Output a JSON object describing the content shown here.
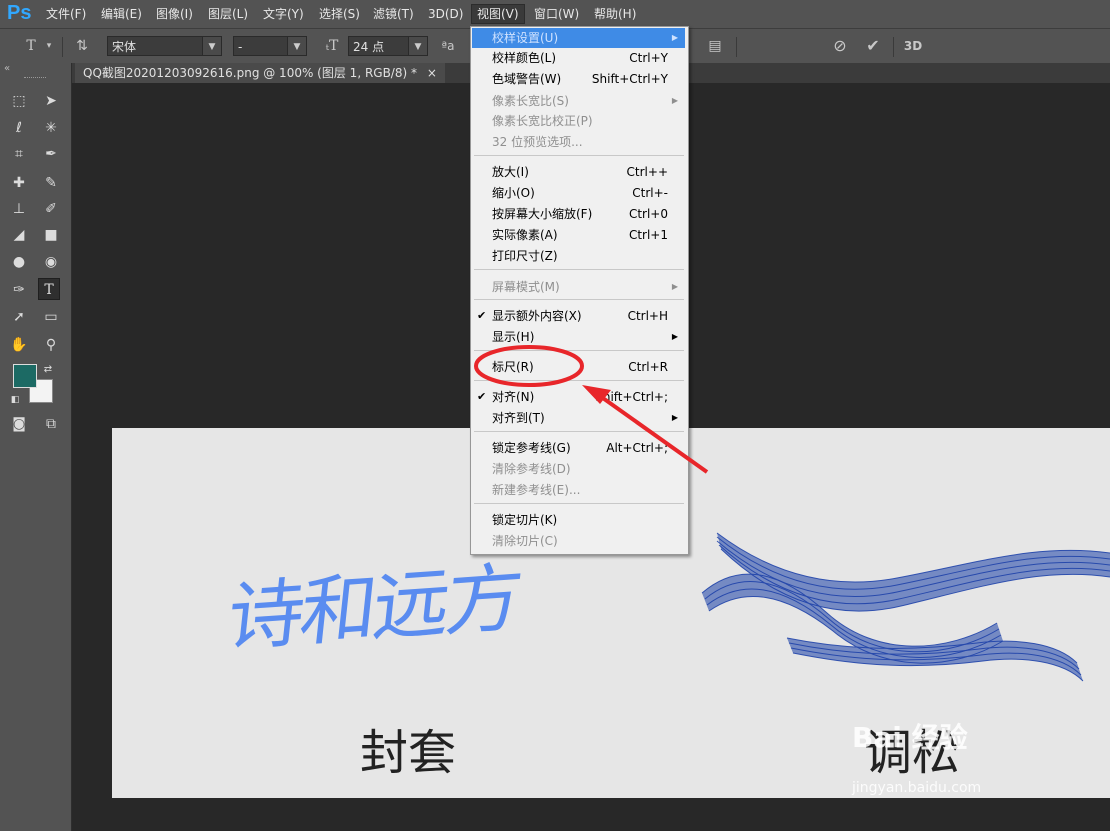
{
  "app": {
    "logo": "Ps"
  },
  "menubar": {
    "items": [
      "文件(F)",
      "编辑(E)",
      "图像(I)",
      "图层(L)",
      "文字(Y)",
      "选择(S)",
      "滤镜(T)",
      "3D(D)",
      "视图(V)",
      "窗口(W)",
      "帮助(H)"
    ],
    "active": "视图(V)"
  },
  "options": {
    "font_family": "宋体",
    "font_style": "-",
    "font_size": "24 点",
    "aa_label": "ªa",
    "three_d_label": "3D"
  },
  "document_tab": {
    "title": "QQ截图20201203092616.png @ 100% (图层 1, RGB/8) *",
    "close": "×"
  },
  "colors": {
    "foreground": "#1c6a64",
    "background": "#f3f3f3",
    "highlight": "#3f8be6",
    "annotation": "#e8262a"
  },
  "view_menu": {
    "items": [
      {
        "label": "校样设置(U)",
        "shortcut": "",
        "submenu": true,
        "disabled": false,
        "checked": false,
        "highlighted": true
      },
      {
        "label": "校样颜色(L)",
        "shortcut": "Ctrl+Y",
        "submenu": false,
        "disabled": false,
        "checked": false
      },
      {
        "label": "色域警告(W)",
        "shortcut": "Shift+Ctrl+Y",
        "submenu": false,
        "disabled": false,
        "checked": false
      },
      {
        "label": "像素长宽比(S)",
        "shortcut": "",
        "submenu": true,
        "disabled": true,
        "checked": false
      },
      {
        "label": "像素长宽比校正(P)",
        "shortcut": "",
        "submenu": false,
        "disabled": true,
        "checked": false
      },
      {
        "label": "32 位预览选项...",
        "shortcut": "",
        "submenu": false,
        "disabled": true,
        "checked": false
      },
      {
        "label": "放大(I)",
        "shortcut": "Ctrl++",
        "submenu": false,
        "disabled": false,
        "checked": false
      },
      {
        "label": "缩小(O)",
        "shortcut": "Ctrl+-",
        "submenu": false,
        "disabled": false,
        "checked": false
      },
      {
        "label": "按屏幕大小缩放(F)",
        "shortcut": "Ctrl+0",
        "submenu": false,
        "disabled": false,
        "checked": false
      },
      {
        "label": "实际像素(A)",
        "shortcut": "Ctrl+1",
        "submenu": false,
        "disabled": false,
        "checked": false
      },
      {
        "label": "打印尺寸(Z)",
        "shortcut": "",
        "submenu": false,
        "disabled": false,
        "checked": false
      },
      {
        "label": "屏幕模式(M)",
        "shortcut": "",
        "submenu": true,
        "disabled": true,
        "checked": false
      },
      {
        "label": "显示额外内容(X)",
        "shortcut": "Ctrl+H",
        "submenu": false,
        "disabled": false,
        "checked": true
      },
      {
        "label": "显示(H)",
        "shortcut": "",
        "submenu": true,
        "disabled": false,
        "checked": false
      },
      {
        "label": "标尺(R)",
        "shortcut": "Ctrl+R",
        "submenu": false,
        "disabled": false,
        "checked": false
      },
      {
        "label": "对齐(N)",
        "shortcut": "Shift+Ctrl+;",
        "submenu": false,
        "disabled": false,
        "checked": true
      },
      {
        "label": "对齐到(T)",
        "shortcut": "",
        "submenu": true,
        "disabled": false,
        "checked": false
      },
      {
        "label": "锁定参考线(G)",
        "shortcut": "Alt+Ctrl+;",
        "submenu": false,
        "disabled": false,
        "checked": false
      },
      {
        "label": "清除参考线(D)",
        "shortcut": "",
        "submenu": false,
        "disabled": true,
        "checked": false
      },
      {
        "label": "新建参考线(E)...",
        "shortcut": "",
        "submenu": false,
        "disabled": true,
        "checked": false
      },
      {
        "label": "锁定切片(K)",
        "shortcut": "",
        "submenu": false,
        "disabled": false,
        "checked": false
      },
      {
        "label": "清除切片(C)",
        "shortcut": "",
        "submenu": false,
        "disabled": true,
        "checked": false
      }
    ]
  },
  "canvas": {
    "title_text": "诗和远方",
    "left_label": "封套",
    "right_label": "调松",
    "watermark": "Bai 经验",
    "watermark_url": "jingyan.baidu.com"
  }
}
